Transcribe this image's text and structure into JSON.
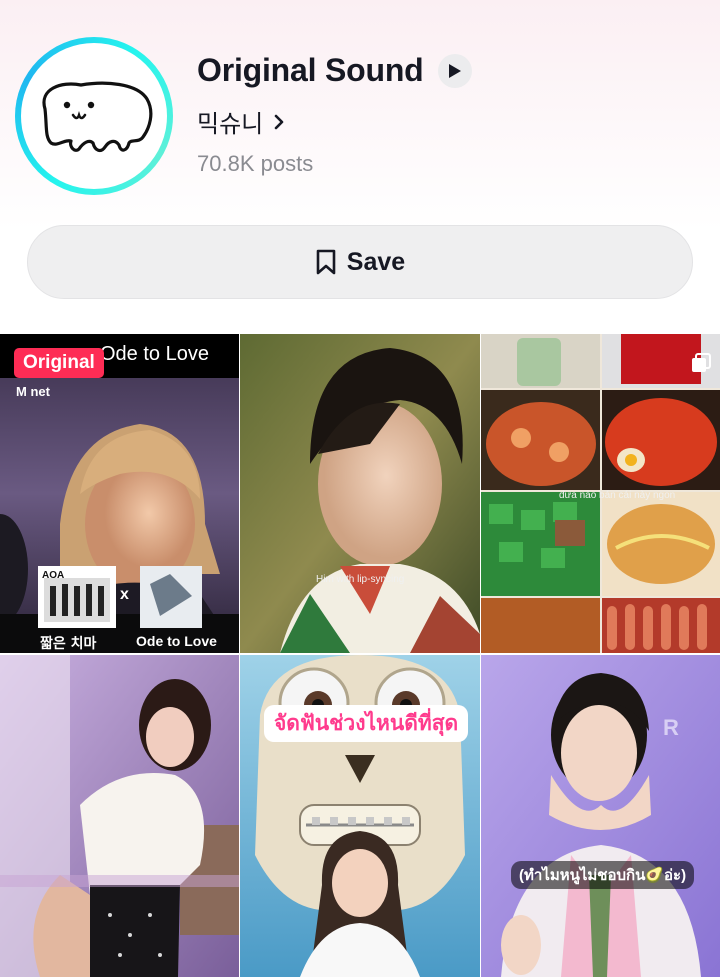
{
  "sound": {
    "title": "Original Sound",
    "artist": "믹슈니",
    "posts": "70.8K posts"
  },
  "actions": {
    "save_label": "Save"
  },
  "icons": {
    "play": "play-icon",
    "chevron": "chevron-right-icon",
    "bookmark": "bookmark-icon",
    "multi": "multi-image-icon"
  },
  "colors": {
    "badge": "#fe2c55",
    "ring": "#25f4ee",
    "muted_text": "#8a8b91"
  },
  "videos": [
    {
      "badge": "Original",
      "top_text": "Ode to Love",
      "channel": "M net",
      "caption_left": "짧은 치마",
      "caption_right": "Ode to Love",
      "cross": "x",
      "album_text": "AOA"
    },
    {
      "caption": "Him with lip-syncing"
    },
    {
      "caption": "đưa nào bán cái này ngon"
    },
    {},
    {
      "caption": "จัดฟันช่วงไหนดีที่สุด"
    },
    {
      "caption": "(ทำไมหนูไม่ชอบกิน🥑อ่ะ)",
      "watermark": "R"
    }
  ]
}
